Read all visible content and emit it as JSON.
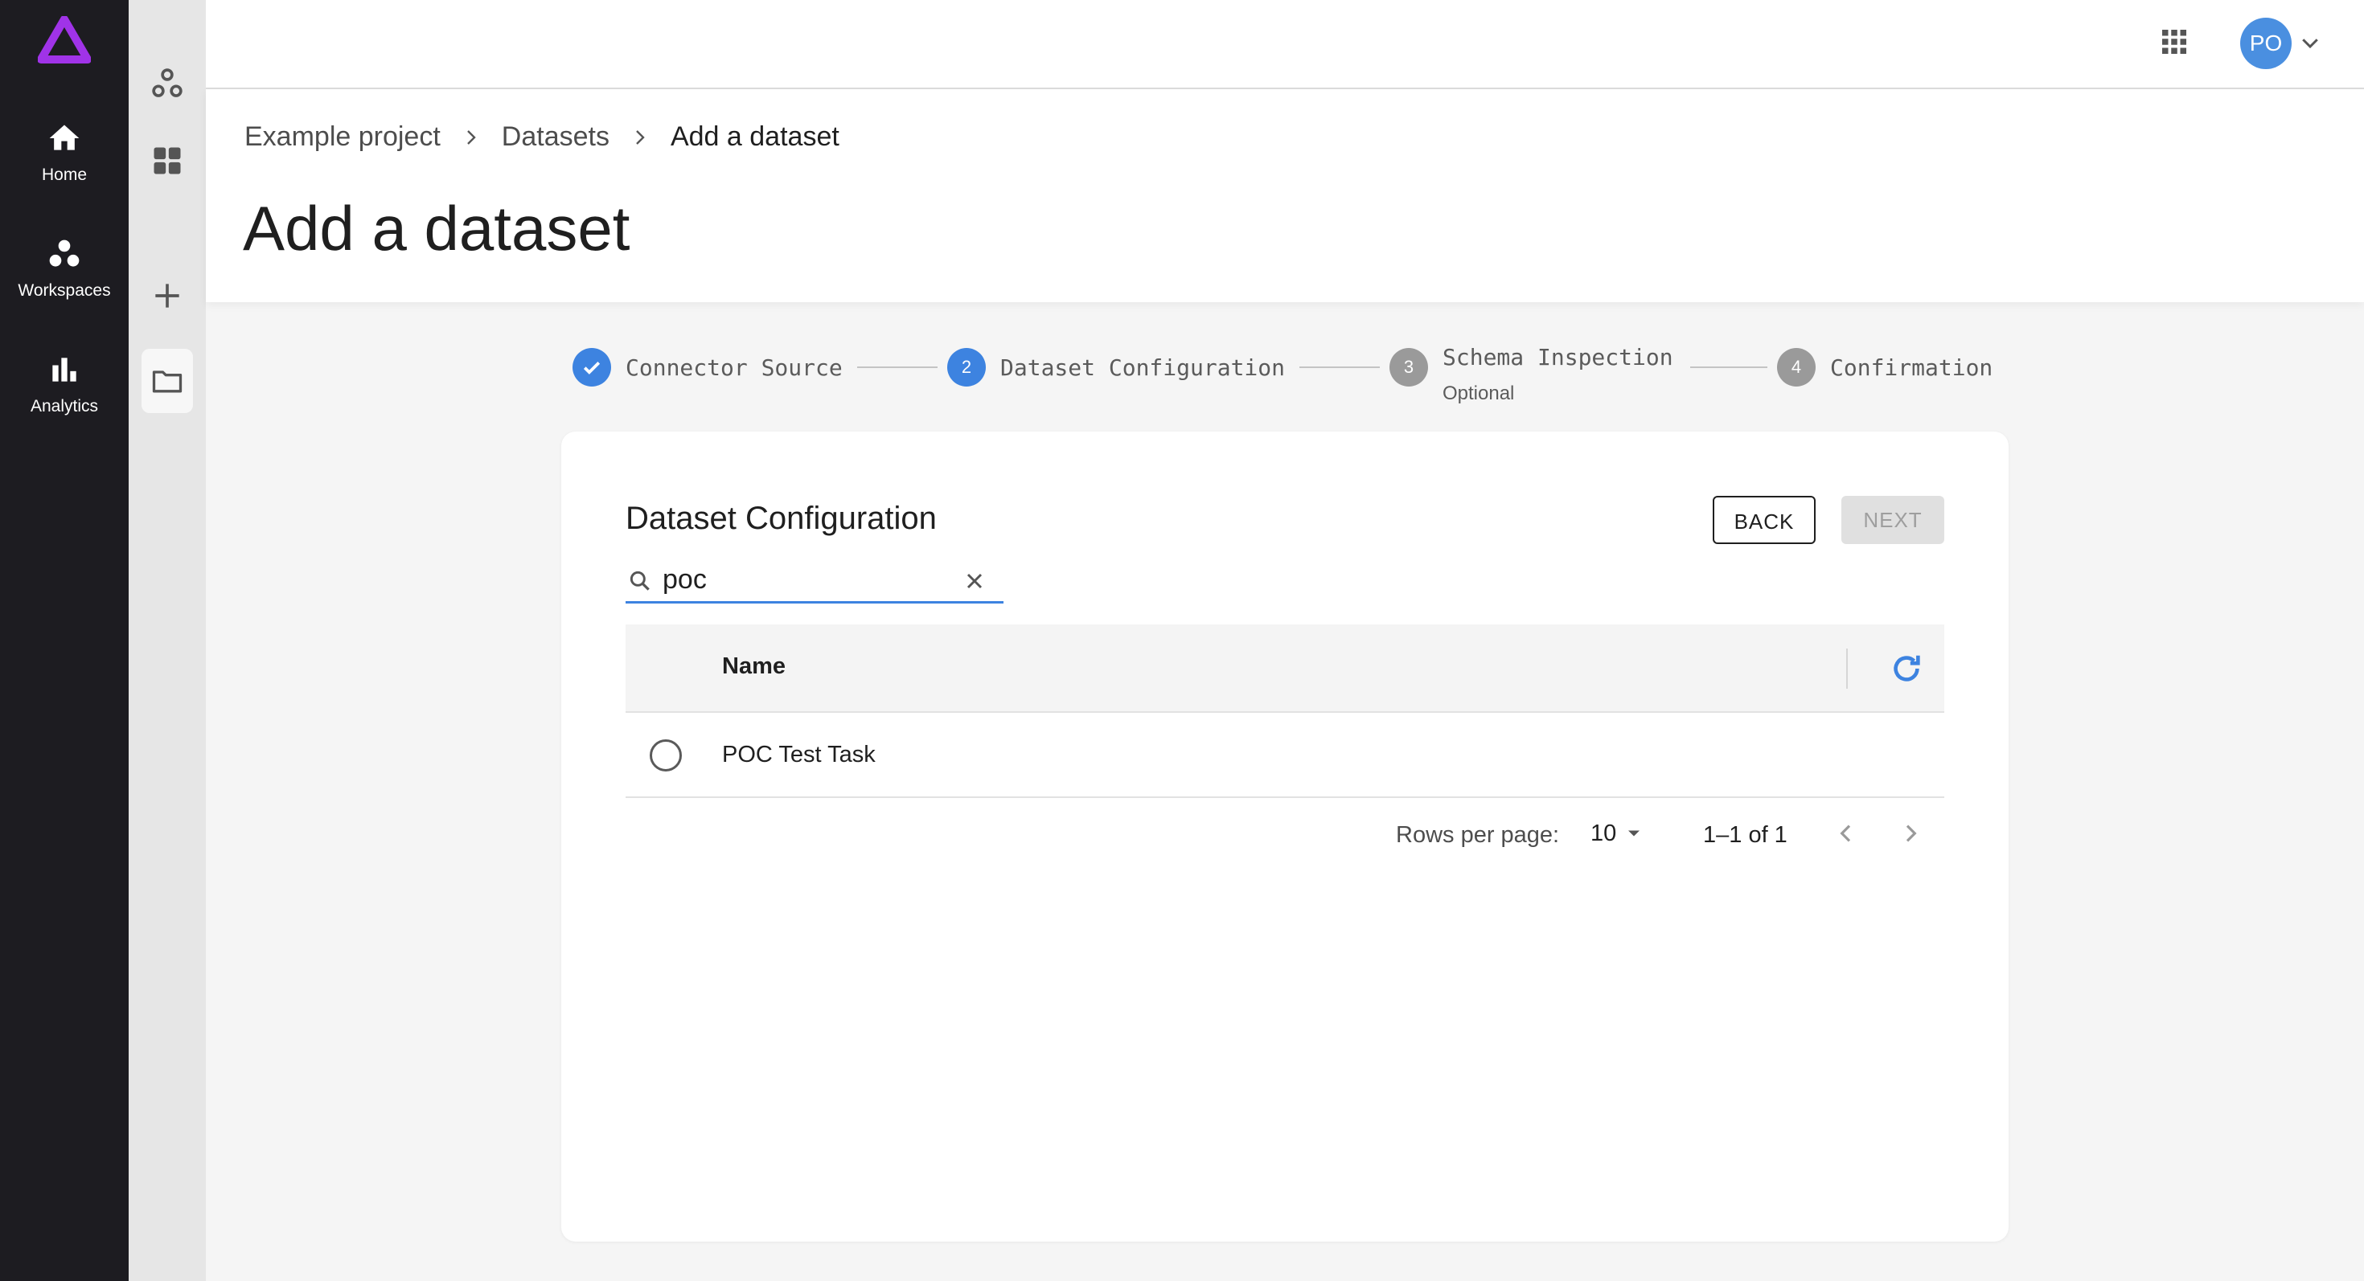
{
  "colors": {
    "accent": "#3d83e0",
    "rail": "#1d1c21",
    "logo": "#a033e8"
  },
  "rail": {
    "items": [
      {
        "label": "Home",
        "icon": "home-icon"
      },
      {
        "label": "Workspaces",
        "icon": "workspaces-icon"
      },
      {
        "label": "Analytics",
        "icon": "analytics-icon"
      }
    ]
  },
  "header": {
    "avatar_initials": "PO"
  },
  "breadcrumb": [
    "Example project",
    "Datasets",
    "Add a dataset"
  ],
  "page_title": "Add a dataset",
  "stepper": {
    "steps": [
      {
        "number": "1",
        "label": "Connector Source",
        "state": "completed"
      },
      {
        "number": "2",
        "label": "Dataset Configuration",
        "state": "active"
      },
      {
        "number": "3",
        "label": "Schema Inspection",
        "sublabel": "Optional",
        "state": "pending"
      },
      {
        "number": "4",
        "label": "Confirmation",
        "state": "pending"
      }
    ]
  },
  "card": {
    "title": "Dataset Configuration",
    "back_label": "BACK",
    "next_label": "NEXT",
    "search_value": "poc",
    "table": {
      "columns": [
        "Name"
      ],
      "rows": [
        {
          "name": "POC Test Task",
          "selected": false
        }
      ]
    },
    "pagination": {
      "rows_per_page_label": "Rows per page:",
      "rows_per_page": "10",
      "range": "1–1 of 1"
    }
  }
}
